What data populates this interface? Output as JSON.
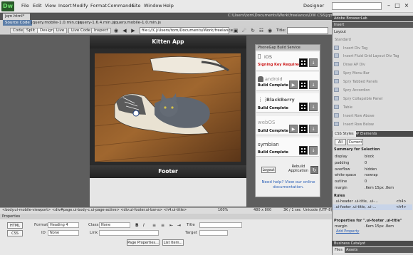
{
  "app": {
    "logo": "Dw",
    "menu": [
      "File",
      "Edit",
      "View",
      "Insert",
      "Modify",
      "Format",
      "Commands",
      "Site",
      "Window",
      "Help"
    ],
    "workspace": "Designer"
  },
  "document": {
    "tab_label": "jqm.html*",
    "path": "C:\\Users\\tom\\Documents\\Work\\freelance\\DW CS6\\jqm.html",
    "related_files": [
      "Source Code",
      "jquery.mobile-1.0.min.css",
      "jquery-1.6.4.min.js",
      "jquery.mobile-1.0.min.js"
    ]
  },
  "toolbar": {
    "buttons": [
      "Code",
      "Split",
      "Design",
      "Live",
      "Live Code",
      "Inspect"
    ],
    "address": "file:///C|/Users/tom/Documents/Work/freelance",
    "title_label": "Title:"
  },
  "design": {
    "header": "Kitten App",
    "footer": "Footer"
  },
  "phonegap": {
    "title": "PhoneGap Build Service",
    "platforms": [
      {
        "name": "iOS",
        "status": "Signing Key Required",
        "status_color": "#cc1a1a"
      },
      {
        "name": "android",
        "status": "Build Complete",
        "status_color": "#111111"
      },
      {
        "name": "BlackBerry",
        "status": "Build Complete",
        "status_color": "#111111"
      },
      {
        "name": "webOS",
        "status": "Build Complete",
        "status_color": "#111111"
      },
      {
        "name": "symbian",
        "status": "Build Complete",
        "status_color": "#111111"
      }
    ],
    "logout": "Logout",
    "rebuild": "Rebuild Application",
    "help": "Need help? View our online documentation."
  },
  "statusbar": {
    "tag_path": "<body.ui-mobile-viewport> <div#page.ui-body-c.ui-page-active> <div.ui-footer.ui-bar-a> <h4.ui-title>",
    "zoom": "100%",
    "dimensions": "480 x 800",
    "download": "3K / 1 sec",
    "encoding": "Unicode (UTF-8)"
  },
  "properties": {
    "title": "Properties",
    "html_label": "HTML",
    "css_label": "CSS",
    "format_label": "Format",
    "format_value": "Heading 4",
    "id_label": "ID",
    "id_value": "None",
    "class_label": "Class",
    "class_value": "None",
    "link_label": "Link",
    "title_label": "Title",
    "target_label": "Target",
    "page_properties": "Page Properties...",
    "list_item": "List Item..."
  },
  "right_panel": {
    "top_header": "Adobe BrowserLab",
    "insert_tab": "Insert",
    "insert_category": "Layout",
    "insert_items": [
      "Standard",
      "Insert Div Tag",
      "Insert Fluid Grid Layout Div Tag",
      "Draw AP Div",
      "Spry Menu Bar",
      "Spry Tabbed Panels",
      "Spry Accordion",
      "Spry Collapsible Panel",
      "Table",
      "Insert Row Above",
      "Insert Row Below"
    ],
    "css_tabs": [
      "CSS Styles",
      "AP Elements"
    ],
    "css_subtabs": [
      "All",
      "Current"
    ],
    "summary_title": "Summary for Selection",
    "summary": [
      {
        "prop": "display",
        "val": "block"
      },
      {
        "prop": "padding",
        "val": "0"
      },
      {
        "prop": "overflow",
        "val": "hidden"
      },
      {
        "prop": "white-space",
        "val": "nowrap"
      },
      {
        "prop": "outline",
        "val": "0"
      },
      {
        "prop": "margin",
        "val": ".6em 15px .8em"
      }
    ],
    "rules_title": "Rules",
    "rules": [
      {
        "sel": ".ui-header .ui-title, .ui-...",
        "src": "<h4>"
      },
      {
        "sel": ".ui-footer .ui-title, .ui-...",
        "src": "<h4>"
      }
    ],
    "props_title": "Properties for \".ui-footer .ui-title\"",
    "props_margin": "margin",
    "props_margin_val": ".6em 15px .8em",
    "add_property": "Add Property",
    "business_catalyst": "Business Catalyst",
    "files_tabs": [
      "Files",
      "Assets"
    ]
  }
}
